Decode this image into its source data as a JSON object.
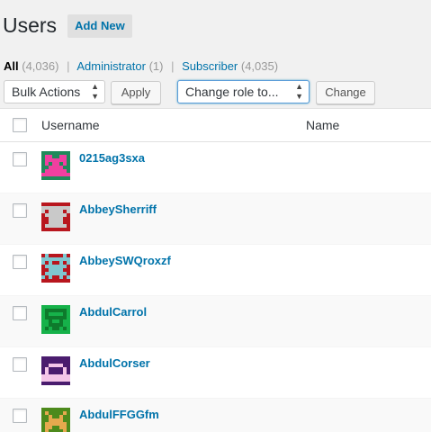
{
  "header": {
    "title": "Users",
    "add_new": "Add New"
  },
  "filters": [
    {
      "label": "All",
      "count": "(4,036)",
      "current": true
    },
    {
      "label": "Administrator",
      "count": "(1)",
      "current": false
    },
    {
      "label": "Subscriber",
      "count": "(4,035)",
      "current": false
    }
  ],
  "filter_separator": "|",
  "toolbar": {
    "bulk_actions": "Bulk Actions",
    "apply": "Apply",
    "change_role": "Change role to...",
    "change": "Change"
  },
  "table": {
    "columns": {
      "username": "Username",
      "name": "Name"
    },
    "rows": [
      {
        "username": "0215ag3sxa",
        "avatar_bg": "#1f8a5a",
        "avatar_fg": "#f03fa0"
      },
      {
        "username": "AbbeySherriff",
        "avatar_bg": "#b8161e",
        "avatar_fg": "#c9c9c9"
      },
      {
        "username": "AbbeySWQroxzf",
        "avatar_bg": "#b8161e",
        "avatar_fg": "#7fc7d0"
      },
      {
        "username": "AbdulCarrol",
        "avatar_bg": "#16b24a",
        "avatar_fg": "#0e7a2c"
      },
      {
        "username": "AbdulCorser",
        "avatar_bg": "#4a1c6e",
        "avatar_fg": "#f4c6e8"
      },
      {
        "username": "AbdulFFGGfm",
        "avatar_bg": "#4d8a1c",
        "avatar_fg": "#e6a94e"
      }
    ]
  },
  "colors": {
    "link": "#0073aa",
    "background": "#f1f1f1"
  }
}
